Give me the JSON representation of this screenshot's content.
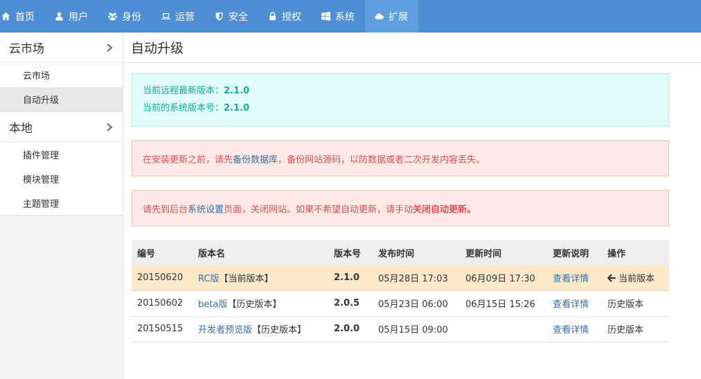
{
  "nav": {
    "items": [
      {
        "label": "首页",
        "icon": "home-icon"
      },
      {
        "label": "用户",
        "icon": "user-icon"
      },
      {
        "label": "身份",
        "icon": "users-icon"
      },
      {
        "label": "运营",
        "icon": "laptop-icon"
      },
      {
        "label": "安全",
        "icon": "shield-icon"
      },
      {
        "label": "授权",
        "icon": "lock-icon"
      },
      {
        "label": "系统",
        "icon": "windows-icon"
      },
      {
        "label": "扩展",
        "icon": "cloud-icon"
      }
    ]
  },
  "sidebar": {
    "groups": [
      {
        "title": "云市场",
        "items": [
          "云市场",
          "自动升级"
        ]
      },
      {
        "title": "本地",
        "items": [
          "插件管理",
          "模块管理",
          "主题管理"
        ]
      }
    ]
  },
  "main": {
    "title": "自动升级",
    "info": {
      "remote_label": "当前远程最新版本：",
      "remote_version": "2.1.0",
      "local_label": "当前的系统版本号：",
      "local_version": "2.1.0"
    },
    "warn1": {
      "pre": "在安装更新之前，请先",
      "link": "备份数据库",
      "post": "，备份网站源码，以防数据或者二次开发内容丢失。"
    },
    "warn2": {
      "pre": "请先到后台",
      "link": "系统设置",
      "mid": "页面，关闭网站。如果不希望自动更新，请手动",
      "bold": "关闭自动更新。"
    },
    "table": {
      "headers": [
        "编号",
        "版本名",
        "版本号",
        "发布时间",
        "更新时间",
        "更新说明",
        "操作"
      ],
      "rows": [
        {
          "id": "20150620",
          "name": "RC版",
          "tag": "【当前版本】",
          "version": "2.1.0",
          "released": "05月28日 17:03",
          "updated": "06月09日 17:30",
          "detail": "查看详情",
          "action": "当前版本"
        },
        {
          "id": "20150602",
          "name": "beta版",
          "tag": "【历史版本】",
          "version": "2.0.5",
          "released": "05月23日 06:00",
          "updated": "06月15日 15:26",
          "detail": "查看详情",
          "action": "历史版本"
        },
        {
          "id": "20150515",
          "name": "开发者预览版",
          "tag": "【历史版本】",
          "version": "2.0.0",
          "released": "05月15日 09:00",
          "updated": "",
          "detail": "查看详情",
          "action": "历史版本"
        }
      ]
    }
  }
}
